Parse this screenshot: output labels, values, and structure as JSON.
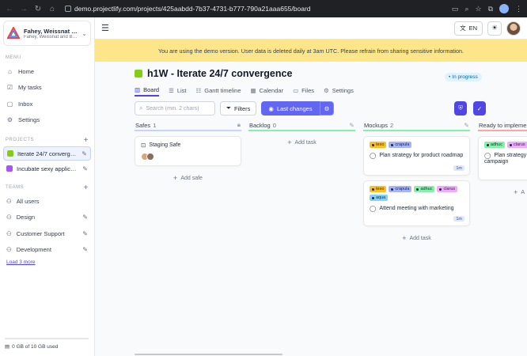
{
  "browser": {
    "url": "demo.projectlify.com/projects/425aabdd-7b37-4731-b777-790a21aaa655/board",
    "nav_icons": [
      "back-icon",
      "forward-icon",
      "reload-icon",
      "home-icon"
    ]
  },
  "sidebar": {
    "workspace": {
      "title": "Fahey, Weissnat an...",
      "subtitle": "Fahey, Weissnat and Bal..."
    },
    "menu_label": "MENU",
    "menu": [
      {
        "label": "Home",
        "icon": "home-icon"
      },
      {
        "label": "My tasks",
        "icon": "tasks-icon"
      },
      {
        "label": "Inbox",
        "icon": "inbox-icon"
      },
      {
        "label": "Settings",
        "icon": "gear-icon"
      }
    ],
    "projects_label": "PROJECTS",
    "projects": [
      {
        "label": "Iterate 24/7 converge...",
        "color": "#84cc16",
        "active": true
      },
      {
        "label": "Incubate sexy applica...",
        "color": "#a855f7",
        "active": false
      }
    ],
    "teams_label": "TEAMS",
    "teams": [
      {
        "label": "All users"
      },
      {
        "label": "Design"
      },
      {
        "label": "Customer Support"
      },
      {
        "label": "Development"
      }
    ],
    "load_more": "Load 3 more",
    "storage": "0 GB of 10 GB used"
  },
  "topbar": {
    "lang": "EN"
  },
  "banner": "You are using the demo version. User data is deleted daily at 3am UTC. Please refrain from sharing sensitive information.",
  "project": {
    "title": "h1W - Iterate 24/7 convergence",
    "status": "In progress",
    "tabs": [
      {
        "label": "Board",
        "icon": "board-icon",
        "active": true
      },
      {
        "label": "List",
        "icon": "list-icon"
      },
      {
        "label": "Gantt timeline",
        "icon": "gantt-icon"
      },
      {
        "label": "Calendar",
        "icon": "calendar-icon"
      },
      {
        "label": "Files",
        "icon": "folder-icon"
      },
      {
        "label": "Settings",
        "icon": "gear-icon"
      }
    ]
  },
  "toolbar": {
    "search_placeholder": "Search (min. 2 chars)",
    "filters": "Filters",
    "last_changes": "Last changes"
  },
  "columns": [
    {
      "name": "Safes",
      "count": "1",
      "color": "#c7d2fe"
    },
    {
      "name": "Backlog",
      "count": "0",
      "color": "#86efac"
    },
    {
      "name": "Mockups",
      "count": "2",
      "color": "#86efac"
    },
    {
      "name": "Ready to implement",
      "count": "",
      "color": "#fca5a5"
    }
  ],
  "safes": {
    "card": "Staging Safe",
    "add": "Add safe"
  },
  "backlog": {
    "add": "Add task"
  },
  "mockups": {
    "cards": [
      {
        "title": "Plan strategy for product roadmap",
        "tags": [
          {
            "label": "texo",
            "color": "#fbbf24"
          },
          {
            "label": "crapula",
            "color": "#a5b4fc"
          }
        ],
        "est": "1m"
      },
      {
        "title": "Attend meeting with marketing",
        "tags": [
          {
            "label": "texo",
            "color": "#fbbf24"
          },
          {
            "label": "crapula",
            "color": "#a5b4fc"
          },
          {
            "label": "adhuc",
            "color": "#86efac"
          },
          {
            "label": "clarus",
            "color": "#f0abfc"
          },
          {
            "label": "aqua",
            "color": "#7dd3fc"
          }
        ],
        "est": "1m"
      }
    ],
    "add": "Add task"
  },
  "ready": {
    "card_title_1": "Plan strategy",
    "card_title_2": "campaign",
    "tags": [
      {
        "label": "adhuc",
        "color": "#86efac"
      },
      {
        "label": "clarus",
        "color": "#f0abfc"
      }
    ],
    "add": "A"
  }
}
